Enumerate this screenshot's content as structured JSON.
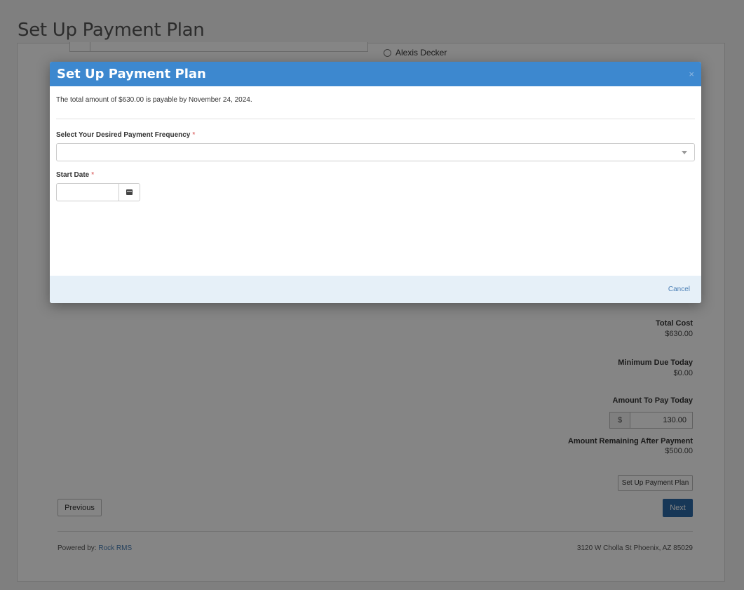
{
  "page": {
    "title": "Set Up Payment Plan"
  },
  "underlying": {
    "radio_option": "Alexis Decker",
    "summary": {
      "total_cost_label": "Total Cost",
      "total_cost_value": "$630.00",
      "minimum_due_label": "Minimum Due Today",
      "minimum_due_value": "$0.00",
      "amount_to_pay_label": "Amount To Pay Today",
      "currency_symbol": "$",
      "amount_to_pay_value": "130.00",
      "remaining_label": "Amount Remaining After Payment",
      "remaining_value": "$500.00"
    },
    "buttons": {
      "payment_plan": "Set Up Payment Plan",
      "previous": "Previous",
      "next": "Next"
    },
    "footer": {
      "powered_prefix": "Powered by:",
      "powered_link": "Rock RMS",
      "address": "3120 W Cholla St Phoenix, AZ 85029"
    }
  },
  "modal": {
    "title": "Set Up Payment Plan",
    "close_glyph": "×",
    "intro_text": "The total amount of $630.00 is payable by November 24, 2024.",
    "frequency_label": "Select Your Desired Payment Frequency",
    "frequency_value": "",
    "start_date_label": "Start Date",
    "start_date_value": "",
    "required_marker": "*",
    "cancel_label": "Cancel"
  },
  "colors": {
    "header_blue": "#3d88cf",
    "primary_button": "#2c6aa8",
    "link_blue": "#4a7fb5",
    "footer_tint": "#e6f0f8"
  }
}
